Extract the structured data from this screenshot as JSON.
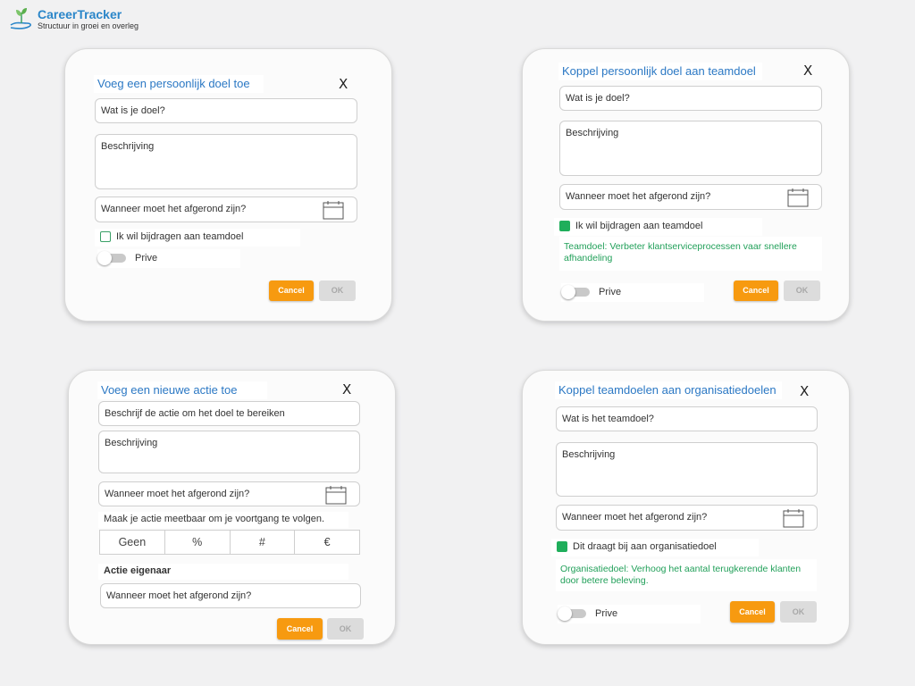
{
  "app": {
    "name": "CareerTracker",
    "tagline": "Structuur in groei en overleg"
  },
  "colors": {
    "accent": "#2b78c4",
    "cancel": "#f79a10",
    "check": "#1fae5b",
    "goal_text": "#22a05a"
  },
  "dialog_personal_goal": {
    "title": "Voeg een persoonlijk doel toe",
    "close": "X",
    "goal_placeholder": "Wat is je doel?",
    "description_placeholder": "Beschrijving",
    "due_placeholder": "Wanneer moet het afgerond zijn?",
    "contribute_label": "Ik wil bijdragen aan teamdoel",
    "contribute_checked": false,
    "private_label": "Prive",
    "cancel": "Cancel",
    "ok": "OK"
  },
  "dialog_link_team_goal": {
    "title": "Koppel persoonlijk doel aan teamdoel",
    "close": "X",
    "goal_placeholder": "Wat is je doel?",
    "description_placeholder": "Beschrijving",
    "due_placeholder": "Wanneer moet het afgerond zijn?",
    "contribute_label": "Ik wil bijdragen aan teamdoel",
    "contribute_checked": true,
    "team_goal_text": "Teamdoel: Verbeter klantserviceprocessen vaar snellere afhandeling",
    "private_label": "Prive",
    "cancel": "Cancel",
    "ok": "OK"
  },
  "dialog_new_action": {
    "title": "Voeg een nieuwe actie toe",
    "close": "X",
    "action_placeholder": "Beschrijf de actie om het doel te bereiken",
    "description_placeholder": "Beschrijving",
    "due_placeholder": "Wanneer moet het afgerond zijn?",
    "measurable_hint": "Maak je actie meetbaar om je voortgang te volgen.",
    "measure_options": [
      "Geen",
      "%",
      "#",
      "€"
    ],
    "owner_label": "Actie eigenaar",
    "owner_placeholder": "Wanneer moet het afgerond zijn?",
    "cancel": "Cancel",
    "ok": "OK"
  },
  "dialog_link_org_goal": {
    "title": "Koppel teamdoelen aan organisatiedoelen",
    "close": "X",
    "goal_placeholder": "Wat is het teamdoel?",
    "description_placeholder": "Beschrijving",
    "due_placeholder": "Wanneer moet het afgerond zijn?",
    "contribute_label": "Dit draagt bij aan organisatiedoel",
    "contribute_checked": true,
    "org_goal_text": "Organisatiedoel: Verhoog het aantal terugkerende klanten door betere beleving.",
    "private_label": "Prive",
    "cancel": "Cancel",
    "ok": "OK"
  }
}
